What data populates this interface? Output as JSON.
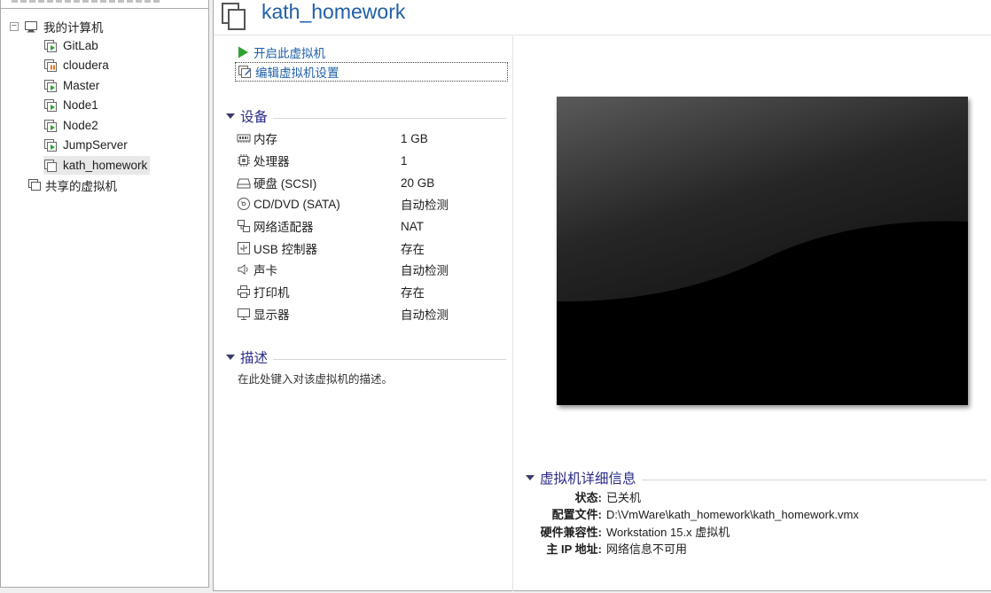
{
  "library": {
    "root_label": "我的计算机",
    "vms": [
      {
        "label": "GitLab",
        "state": "off"
      },
      {
        "label": "cloudera",
        "state": "suspended"
      },
      {
        "label": "Master",
        "state": "off"
      },
      {
        "label": "Node1",
        "state": "off"
      },
      {
        "label": "Node2",
        "state": "off"
      },
      {
        "label": "JumpServer",
        "state": "off"
      },
      {
        "label": "kath_homework",
        "state": "selected"
      }
    ],
    "shared_label": "共享的虚拟机"
  },
  "vm": {
    "title": "kath_homework",
    "actions": {
      "power_on": "开启此虚拟机",
      "edit_settings": "编辑虚拟机设置"
    }
  },
  "devices": {
    "heading": "设备",
    "items": [
      {
        "name": "内存",
        "value": "1 GB",
        "icon": "memory-icon"
      },
      {
        "name": "处理器",
        "value": "1",
        "icon": "cpu-icon"
      },
      {
        "name": "硬盘 (SCSI)",
        "value": "20 GB",
        "icon": "hard-disk-icon"
      },
      {
        "name": "CD/DVD (SATA)",
        "value": "自动检测",
        "icon": "cd-dvd-icon"
      },
      {
        "name": "网络适配器",
        "value": "NAT",
        "icon": "network-adapter-icon"
      },
      {
        "name": "USB 控制器",
        "value": "存在",
        "icon": "usb-icon"
      },
      {
        "name": "声卡",
        "value": "自动检测",
        "icon": "sound-card-icon"
      },
      {
        "name": "打印机",
        "value": "存在",
        "icon": "printer-icon"
      },
      {
        "name": "显示器",
        "value": "自动检测",
        "icon": "display-icon"
      }
    ]
  },
  "description": {
    "heading": "描述",
    "placeholder": "在此处键入对该虚拟机的描述。"
  },
  "details": {
    "heading": "虚拟机详细信息",
    "rows": [
      {
        "key": "状态:",
        "value": "已关机"
      },
      {
        "key": "配置文件:",
        "value": "D:\\VmWare\\kath_homework\\kath_homework.vmx"
      },
      {
        "key": "硬件兼容性:",
        "value": "Workstation 15.x 虚拟机"
      },
      {
        "key": "主 IP 地址:",
        "value": "网络信息不可用"
      }
    ]
  },
  "colors": {
    "link_blue": "#1f5fa8",
    "section_heading": "#2b2b8a",
    "play_green": "#2ea12e",
    "screen_bg": "#000000"
  }
}
